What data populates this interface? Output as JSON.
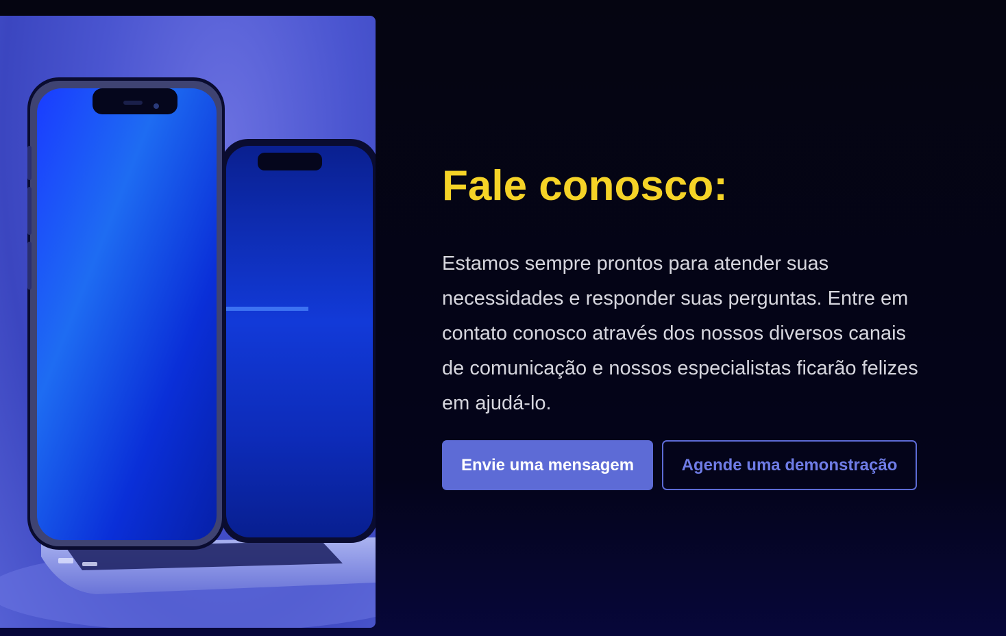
{
  "hero": {
    "image_icon": "phones-laptop-illustration"
  },
  "contact": {
    "title": "Fale conosco:",
    "description": "Estamos sempre prontos para atender suas necessidades e responder suas perguntas. Entre em contato conosco através dos nossos diversos canais de comunicação e nossos especialistas ficarão felizes em ajudá-lo.",
    "primary_button": "Envie uma mensagem",
    "secondary_button": "Agende uma demonstração"
  },
  "colors": {
    "background": "#050511",
    "title": "#f5d327",
    "accent": "#5d6bd6",
    "text": "#d6d6de"
  }
}
